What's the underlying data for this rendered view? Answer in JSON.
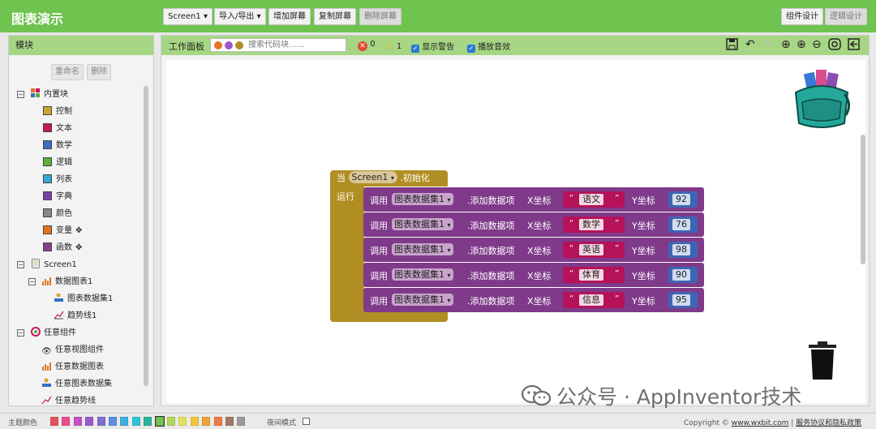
{
  "app": {
    "title": "图表演示"
  },
  "toolbar": {
    "screen": "Screen1",
    "import_export": "导入/导出",
    "add_screen": "增加屏幕",
    "copy_screen": "复制屏幕",
    "delete_screen": "删除屏幕",
    "designer": "组件设计",
    "blocks": "逻辑设计"
  },
  "left": {
    "title": "模块",
    "rename": "重命名",
    "delete": "删除",
    "builtin": "内置块",
    "items": [
      {
        "label": "控制",
        "color": "#c9a72e"
      },
      {
        "label": "文本",
        "color": "#c41560"
      },
      {
        "label": "数学",
        "color": "#3a6fc4"
      },
      {
        "label": "逻辑",
        "color": "#5aad3f"
      },
      {
        "label": "列表",
        "color": "#37a6d6"
      },
      {
        "label": "字典",
        "color": "#7a3fa4"
      },
      {
        "label": "颜色",
        "color": "#888888"
      },
      {
        "label": "变量",
        "color": "#e3741d"
      },
      {
        "label": "函数",
        "color": "#8a3f8a"
      }
    ],
    "screen": "Screen1",
    "chart": "数据图表1",
    "chart_data1": "图表数据集1",
    "trendline": "趋势线1",
    "any_component": "任意组件",
    "any_items": [
      "任意视图组件",
      "任意数据图表",
      "任意图表数据集",
      "任意趋势线"
    ]
  },
  "workspace": {
    "title": "工作面板",
    "search_placeholder": "搜索代码块......",
    "errors": "0",
    "warnings": "1",
    "show_warnings": "显示警告",
    "play_sound": "播放音效"
  },
  "blocks": {
    "when": "当",
    "screen": "Screen1",
    "init": ".初始化",
    "run": "运行",
    "call": "调用",
    "component": "图表数据集1",
    "method": ".添加数据项",
    "x_label": "X坐标",
    "y_label": "Y坐标",
    "quote": "“",
    "quote_end": "”",
    "rows": [
      {
        "x": "语文",
        "y": "92"
      },
      {
        "x": "数学",
        "y": "76"
      },
      {
        "x": "英语",
        "y": "98"
      },
      {
        "x": "体育",
        "y": "90"
      },
      {
        "x": "信息",
        "y": "95"
      }
    ]
  },
  "watermark": "公众号 · AppInventor技术",
  "footer": {
    "theme_label": "主题颜色",
    "theme_colors": [
      "#e0525d",
      "#e84e8a",
      "#c653c6",
      "#9b59c9",
      "#7d6ed0",
      "#5b8fe0",
      "#3ab0e6",
      "#2cc4d6",
      "#2ab59a",
      "#6fc34f",
      "#b3d65a",
      "#e3e35a",
      "#f5c73a",
      "#f0a23a",
      "#ec7c4a",
      "#a07a66",
      "#9a9a9a"
    ],
    "night_mode": "夜间模式",
    "copyright_prefix": "Copyright ©",
    "site": "www.wxbit.com",
    "sep": "|",
    "policy": "服务协议和隐私政策"
  }
}
